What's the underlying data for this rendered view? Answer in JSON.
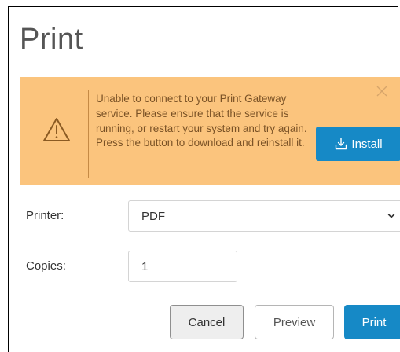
{
  "dialog": {
    "title": "Print"
  },
  "alert": {
    "message": "Unable to connect to your Print Gateway service. Please ensure that the service is running, or restart your system and try again. Press the button to download and reinstall it.",
    "icon": "warning-triangle-icon",
    "close_icon": "close-icon",
    "install_label": "Install",
    "install_icon": "download-icon",
    "background_color": "#fbc47d",
    "text_color": "#7a5226"
  },
  "form": {
    "printer_label": "Printer:",
    "printer_value": "PDF",
    "copies_label": "Copies:",
    "copies_value": "1"
  },
  "actions": {
    "cancel_label": "Cancel",
    "preview_label": "Preview",
    "print_label": "Print",
    "primary_color": "#1689c6"
  }
}
